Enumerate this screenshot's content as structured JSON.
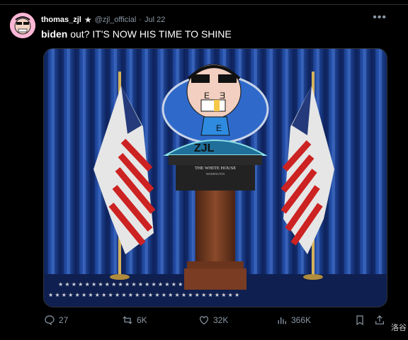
{
  "tweet": {
    "author_name": "thomas_zjl",
    "handle": "@zjl_official",
    "separator": "·",
    "time": "Jul 22",
    "text_bold": "biden",
    "text_rest": " out? IT'S NOW HIS TIME TO SHINE"
  },
  "image": {
    "podium_sign_line1": "THE WHITE HOUSE",
    "podium_sign_line2": "WASHINGTON",
    "drawn_text": "ZJL"
  },
  "actions": {
    "replies": "27",
    "reposts": "6K",
    "likes": "32K",
    "views": "366K"
  },
  "overlay": {
    "corner_text": "洛谷"
  },
  "colors": {
    "background": "#000000",
    "muted": "#8b98a5",
    "curtain": "#1b3c86",
    "floor": "#0f1f4f"
  }
}
